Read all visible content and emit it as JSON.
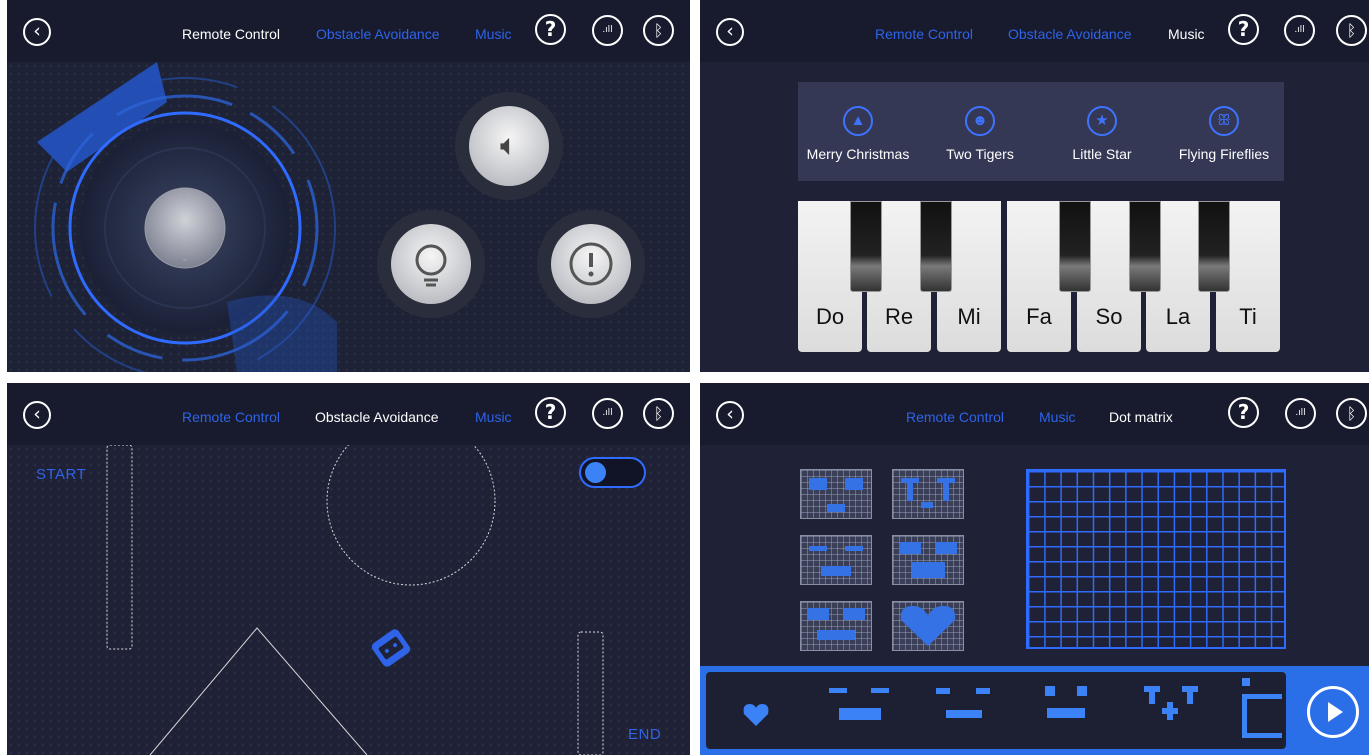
{
  "colors": {
    "accent": "#2f63e8",
    "background": "#1f2237",
    "topbar": "#181b2d",
    "active_tab": "#ffffff"
  },
  "icons": {
    "back": "chevron-left-icon",
    "help": "question-icon",
    "signal": "signal-icon",
    "bluetooth": "bluetooth-icon"
  },
  "panel_remote": {
    "tabs": [
      "Remote Control",
      "Obstacle Avoidance",
      "Music"
    ],
    "active_tab": "Remote Control",
    "buttons": [
      "speaker-icon",
      "bulb-icon",
      "alert-icon"
    ]
  },
  "panel_music": {
    "tabs": [
      "Remote Control",
      "Obstacle Avoidance",
      "Music"
    ],
    "active_tab": "Music",
    "songs": [
      "Merry Christmas",
      "Two Tigers",
      "Little Star",
      "Flying Fireflies"
    ],
    "keys": [
      "Do",
      "Re",
      "Mi",
      "Fa",
      "So",
      "La",
      "Ti"
    ]
  },
  "panel_obstacle": {
    "tabs": [
      "Remote Control",
      "Obstacle Avoidance",
      "Music"
    ],
    "active_tab": "Obstacle Avoidance",
    "start_label": "START",
    "end_label": "END",
    "toggle_on": true
  },
  "panel_dot": {
    "tabs": [
      "Remote Control",
      "Music",
      "Dot matrix"
    ],
    "active_tab": "Dot matrix"
  }
}
